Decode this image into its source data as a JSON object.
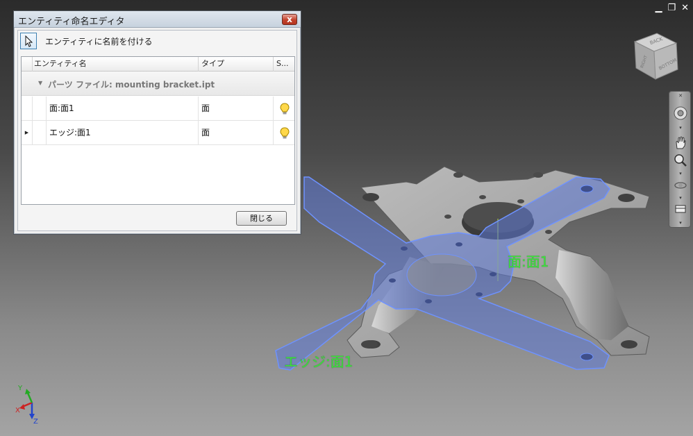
{
  "window_controls": {
    "minimize": "▁",
    "restore": "❐",
    "close": "✕"
  },
  "dialog": {
    "title": "エンティティ命名エディタ",
    "close_glyph": "x",
    "toolbar_label": "エンティティに名前を付ける",
    "columns": {
      "name": "エンティティ名",
      "type": "タイプ",
      "status": "S..."
    },
    "group": {
      "label": "パーツ ファイル: mounting bracket.ipt"
    },
    "rows": [
      {
        "name": "面:面1",
        "type": "面",
        "status_icon": "lightbulb-icon"
      },
      {
        "name": "エッジ:面1",
        "type": "面",
        "status_icon": "lightbulb-icon"
      }
    ],
    "close_button": "閉じる"
  },
  "viewcube": {
    "face_back": "BACK",
    "face_right": "RIGHT",
    "face_bottom": "BOTTOM"
  },
  "model_labels": {
    "face": "面:面1",
    "edge": "エッジ:面1"
  },
  "triad": {
    "x": "X",
    "y": "Y",
    "z": "Z"
  },
  "colors": {
    "selection_highlight": "#5c79d6",
    "label_green": "#3ee23e",
    "part_gray": "#a8a8a8"
  }
}
